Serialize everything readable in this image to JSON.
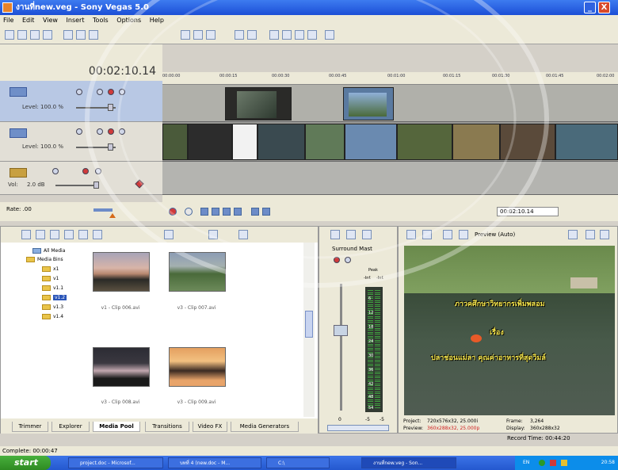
{
  "window": {
    "title": "งานที่new.veg - Sony Vegas 5.0",
    "minimize": "_",
    "close": "X"
  },
  "menu": [
    "File",
    "Edit",
    "View",
    "Insert",
    "Tools",
    "Options",
    "Help"
  ],
  "timeline": {
    "timecode": "00:02:10.14",
    "ruler_marks": [
      "00:00:00",
      "00:00:15",
      "00:00:30",
      "00:00:45",
      "00:01:00",
      "00:01:15",
      "00:01:30",
      "00:01:45",
      "00:02:00"
    ],
    "tracks": [
      {
        "level": "Level: 100.0 %"
      },
      {
        "level": "Level: 100.0 %"
      },
      {
        "vol_label": "Vol:",
        "vol_value": "2.0 dB"
      }
    ],
    "rate_label": "Rate: .00",
    "record_time_box": "00:02:10.14"
  },
  "explorer": {
    "tree": [
      {
        "label": "All Media"
      },
      {
        "label": "Media Bins"
      },
      {
        "label": "x1"
      },
      {
        "label": "v1"
      },
      {
        "label": "v1.1"
      },
      {
        "label": "v1.2",
        "selected": true
      },
      {
        "label": "v1.3"
      },
      {
        "label": "v1.4"
      }
    ],
    "thumbs": [
      {
        "label": "v1 - Clip 006.avi"
      },
      {
        "label": "v3 - Clip 007.avi"
      },
      {
        "label": "v3 - Clip 008.avi"
      },
      {
        "label": "v3 - Clip 009.avi"
      }
    ],
    "tabs": [
      "Trimmer",
      "Explorer",
      "Media Pool",
      "Transitions",
      "Video FX",
      "Media Generators"
    ],
    "active_tab": "Media Pool"
  },
  "mixer": {
    "title": "Surround Mast",
    "peak_label": "Peak",
    "peak_left": "-Inf.",
    "peak_right": "-Inf.",
    "scale": [
      "6",
      "12",
      "18",
      "24",
      "30",
      "36",
      "42",
      "48",
      "54"
    ],
    "bottom_left": "-5",
    "bottom_right": "-5",
    "fader_zero": "0"
  },
  "preview": {
    "mode": "Preview (Auto)",
    "overlay_lines": [
      "ภาวคศึกษาวิทยากรเพิ่มพลอม",
      "เรื่อง",
      "ปลาช่อนแม่ลา คุณค่าอาหารที่สุดวิมล์"
    ],
    "project_label": "Project:",
    "project_value": "720x576x32, 25.000i",
    "preview_label": "Preview:",
    "preview_value": "360x288x32, 25.000p",
    "frame_label": "Frame:",
    "frame_value": "3,264",
    "display_label": "Display:",
    "display_value": "360x288x32",
    "record_time": "Record Time: 00:44:20"
  },
  "status": {
    "text": "Complete: 00:00:47"
  },
  "taskbar": {
    "start": "start",
    "tasks": [
      "project.doc - Microsof...",
      "บทที่ 4 (new.doc - M...",
      "C:\\",
      "งานที่new.veg - Son..."
    ],
    "tray_lang": "EN",
    "clock": "20:58"
  },
  "colors": {
    "accent": "#2458cf",
    "title_bar": "#1c4fd6",
    "selection": "#2a55b8",
    "overlay_text": "#f8e84c"
  }
}
